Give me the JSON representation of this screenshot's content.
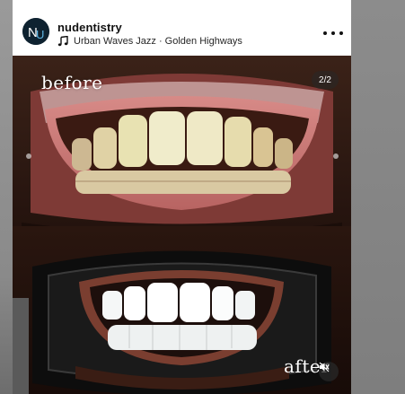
{
  "post": {
    "username": "nudentistry",
    "avatar_initials": "NU",
    "audio": "Urban Waves Jazz · Golden Highways",
    "menu_icon": "more-horizontal-icon"
  },
  "media": {
    "counter": "2/2",
    "before_label": "before",
    "after_label": "after",
    "mute_icon": "speaker-muted-icon"
  },
  "colors": {
    "avatar_bg": "#0e2230",
    "avatar_accent": "#5fb7e6",
    "counter_bg": "#3a3a3a"
  }
}
